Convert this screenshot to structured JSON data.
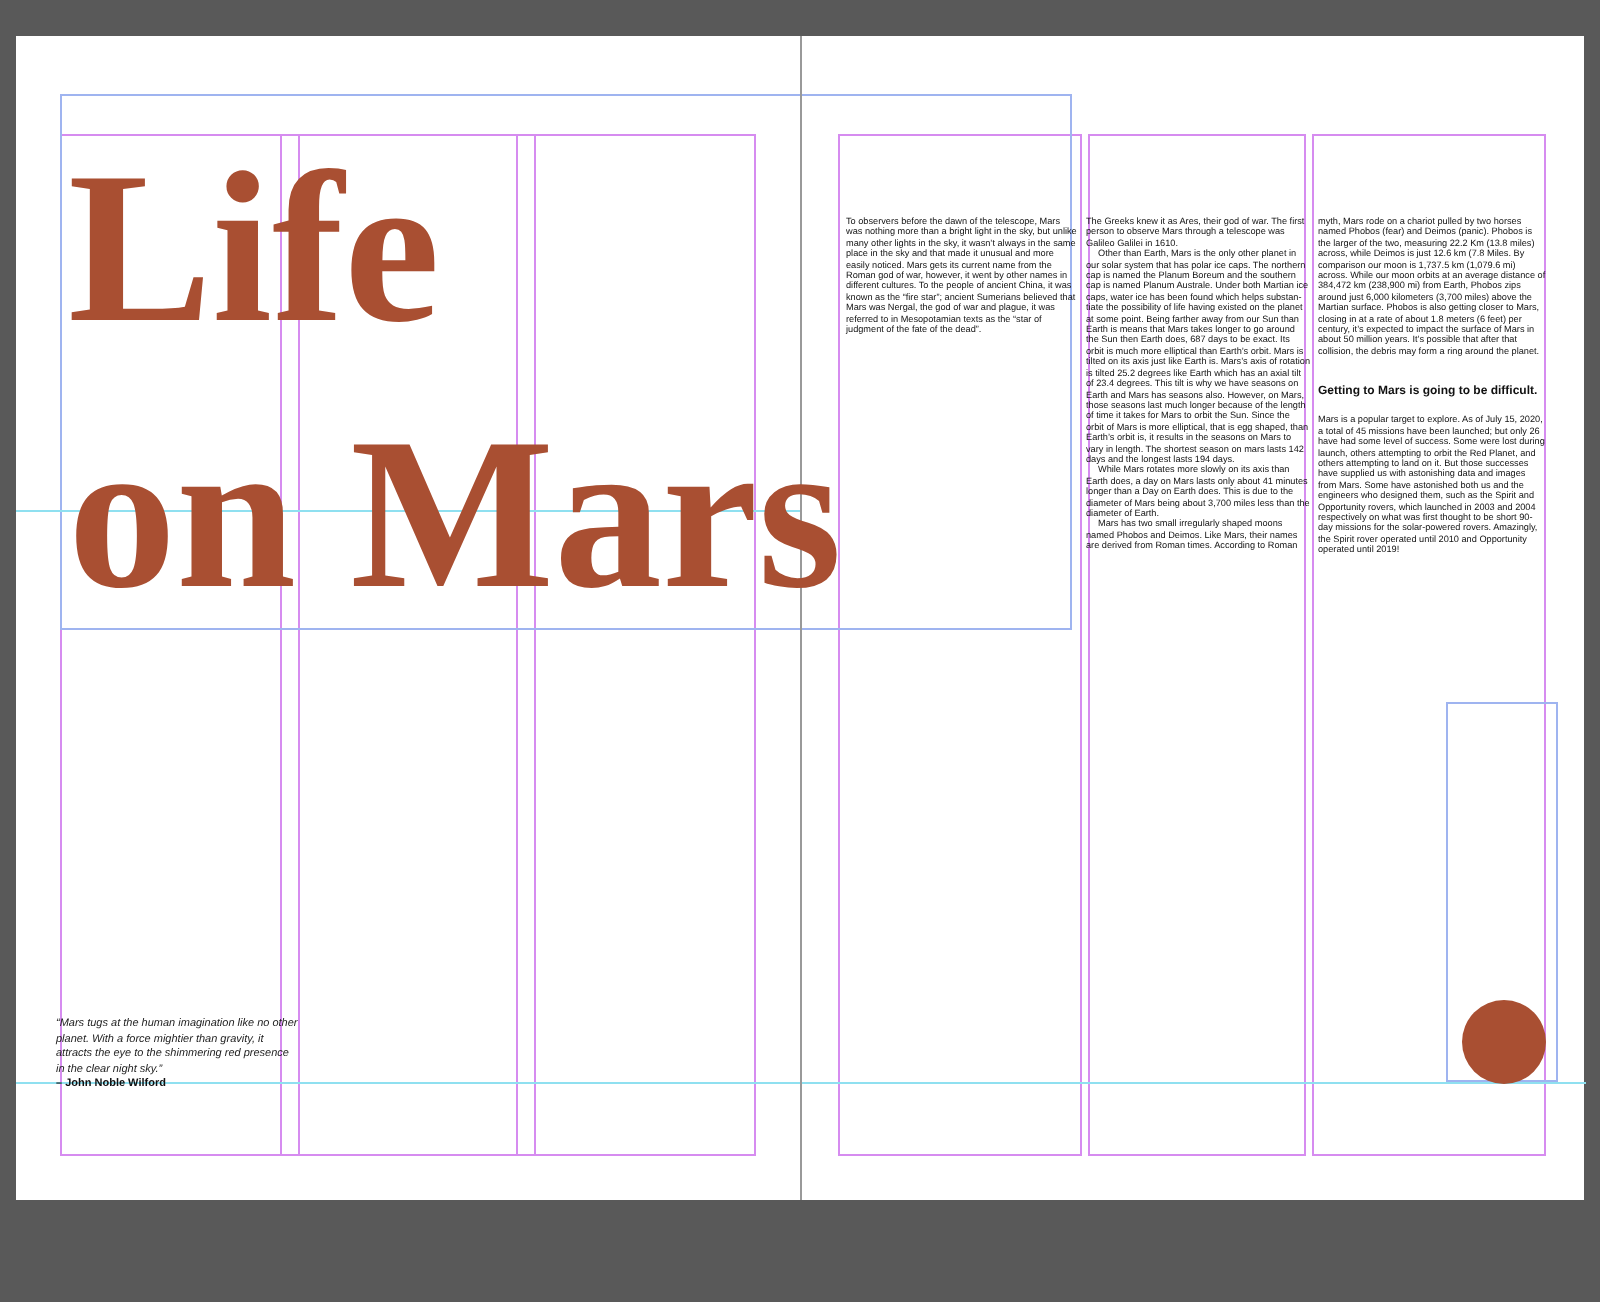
{
  "left_page": {
    "title_lines": [
      "Life",
      "on Mars"
    ],
    "quote": {
      "text": "“Mars tugs at the human imagination like no other planet. With a force mightier than gravity, it attracts the eye to the shimmering red presence in the clear night sky.”",
      "attribution": "– John Noble Wilford"
    }
  },
  "right_page": {
    "columns": [
      [
        {
          "kind": "paragraph",
          "text": "To observers before the dawn of the telescope, Mars was nothing more than a bright light in the sky, but unlike many other lights in the sky, it wasn’t always in the same place in the sky and that made it unusual and more easily noticed. Mars gets its current name from the Roman god of war, however, it went by other names in different cultures. To the people of ancient China, it was known as the “fire star”; ancient Sumerians believed that Mars was Nergal, the god of war and plague, it was referred to in Mesopotamian texts as the “star of judgment of the fate of the dead”."
        }
      ],
      [
        {
          "kind": "paragraph",
          "text": "The Greeks knew it as Ares, their god of war. The first person to observe Mars through a telescope was Galileo Galilei in 1610."
        },
        {
          "kind": "paragraph",
          "text": "Other than Earth, Mars is the only other planet in our solar system that has polar ice caps. The northern cap is named the Planum Boreum and the southern cap is named Planum Australe. Under both Martian ice caps, water ice has been found which helps substan-tiate the possibility of life having existed on the planet at some point. Being farther away from our Sun than Earth is means that Mars takes longer to go around the Sun then Earth does, 687 days to be exact. Its orbit is much more elliptical than Earth’s orbit. Mars is tilted on its axis just like Earth is. Mars’s axis of rotation is tilted 25.2 degrees like Earth which has an axial tilt of 23.4 degrees. This tilt is why we have seasons on Earth and Mars has seasons also. However, on Mars, those seasons last much longer because of the length of time it takes for Mars to orbit the Sun. Since the orbit of Mars is more elliptical, that is egg shaped, than Earth’s orbit is, it results in the seasons on Mars to vary in length. The shortest season on mars lasts 142 days and the longest lasts 194 days."
        },
        {
          "kind": "paragraph",
          "text": "While Mars rotates more slowly on its axis than Earth does, a day on Mars lasts only about 41 minutes longer than a Day on Earth does. This is due to the diameter of Mars being about 3,700 miles less than the diameter of Earth."
        },
        {
          "kind": "paragraph",
          "text": "Mars has two small irregularly shaped moons named Phobos and Deimos. Like Mars, their names are derived from Roman times. According to Roman"
        }
      ],
      [
        {
          "kind": "paragraph",
          "text": "myth, Mars rode on a chariot pulled by two horses named Phobos (fear) and Deimos (panic). Phobos is the larger of the two, measuring 22.2 Km (13.8 miles) across, while Deimos is just 12.6 km (7.8 Miles. By comparison our moon is 1,737.5 km (1,079.6 mi) across. While our moon orbits at an average distance of 384,472 km (238,900 mi) from Earth, Phobos zips around just 6,000 kilometers (3,700 miles) above the Martian surface. Phobos is also getting closer to Mars, closing in at a rate of about 1.8 meters (6 feet) per century, it’s expected to impact the surface of Mars in about 50 million years. It’s possible that after that collision, the debris may form a ring around the planet."
        },
        {
          "kind": "heading",
          "text": "Getting to Mars is going to be difficult."
        },
        {
          "kind": "paragraph",
          "text": "Mars is a popular target to explore. As of July 15, 2020, a total of 45 missions have been launched; but only 26 have had some level of success. Some were lost during launch, others attempting to orbit the Red Planet, and others attempting to land on it. But those successes have supplied us with astonishing data and images from Mars. Some have astonished both us and the engineers who designed them, such as the Spirit and Opportunity rovers, which launched in 2003 and 2004 respectively on what was first thought to be short 90-day missions for the solar-powered rovers. Amazingly, the Spirit rover operated until 2010 and Opportunity operated until 2019!"
        }
      ]
    ]
  }
}
